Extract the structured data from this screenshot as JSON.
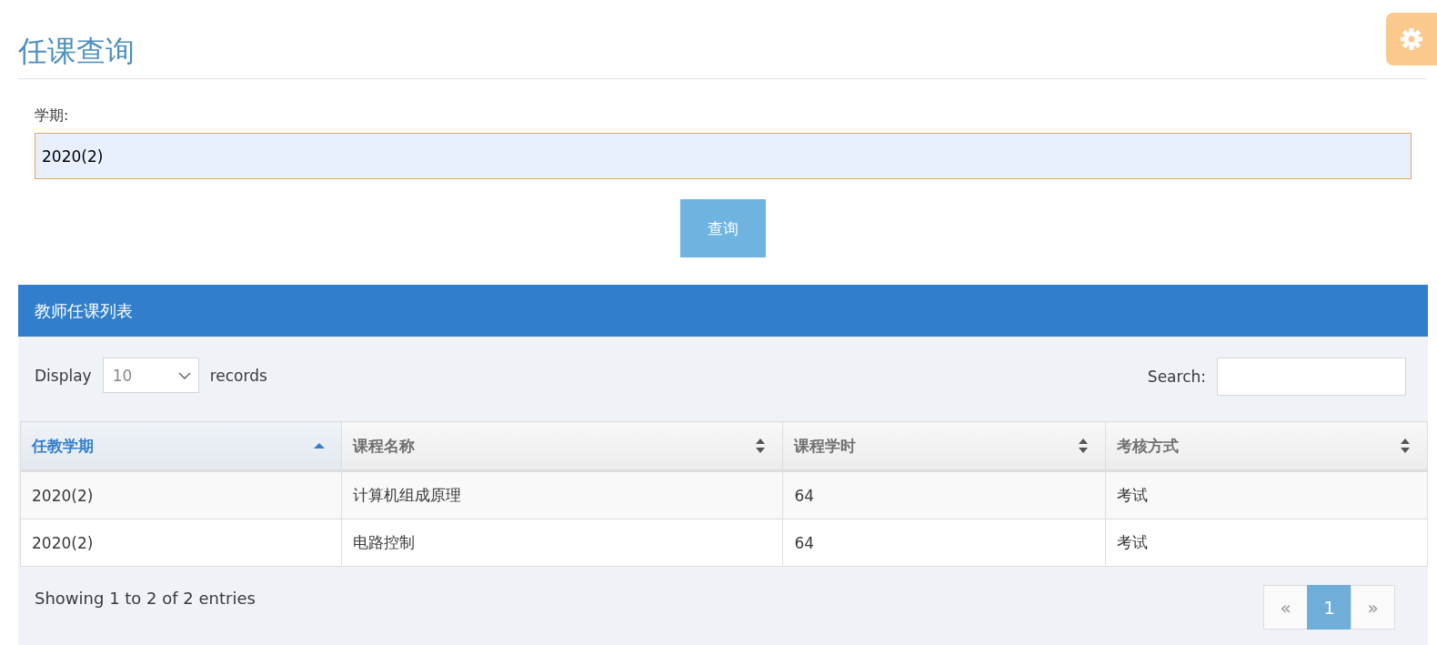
{
  "page_title": "任课查询",
  "form": {
    "label": "学期:",
    "value": "2020(2)",
    "button": "查询"
  },
  "panel": {
    "title": "教师任课列表",
    "length": {
      "before": "Display",
      "value": "10",
      "after": "records"
    },
    "search": {
      "label": "Search:"
    },
    "columns": [
      {
        "label": "任教学期",
        "sorted": true
      },
      {
        "label": "课程名称",
        "sorted": false
      },
      {
        "label": "课程学时",
        "sorted": false
      },
      {
        "label": "考核方式",
        "sorted": false
      }
    ],
    "rows": [
      [
        "2020(2)",
        "计算机组成原理",
        "64",
        "考试"
      ],
      [
        "2020(2)",
        "电路控制",
        "64",
        "考试"
      ]
    ],
    "info": "Showing 1 to 2 of 2 entries",
    "pages": [
      {
        "label": "«",
        "selected": false
      },
      {
        "label": "1",
        "selected": true
      },
      {
        "label": "»",
        "selected": false
      }
    ]
  }
}
